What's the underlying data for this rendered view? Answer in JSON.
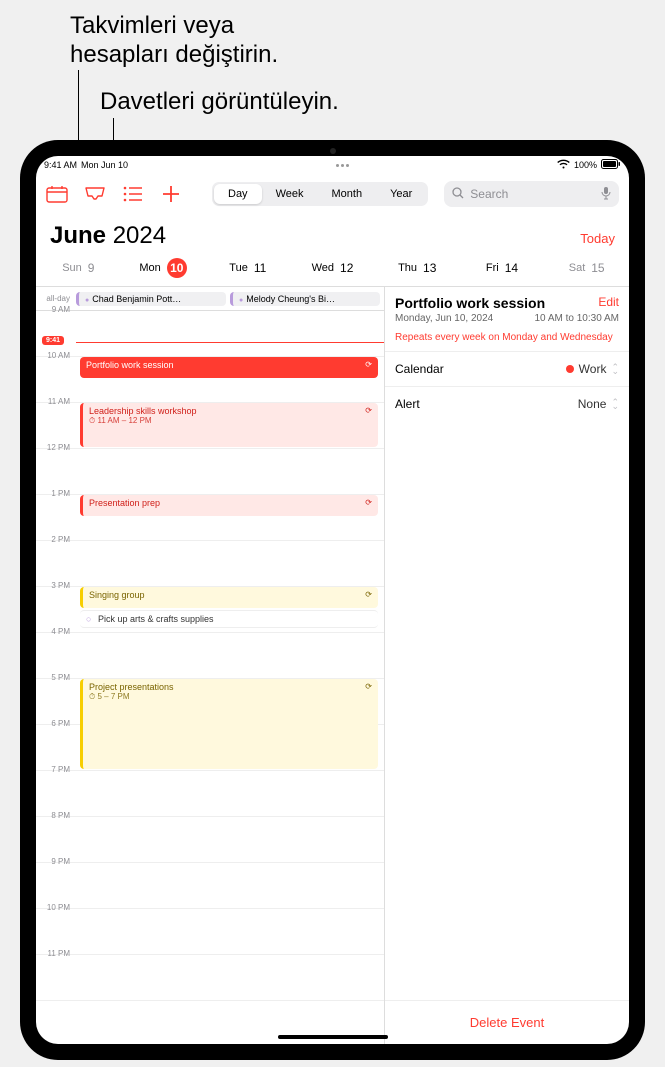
{
  "callouts": {
    "calendars": "Takvimleri veya\nhesapları değiştirin.",
    "invites": "Davetleri görüntüleyin."
  },
  "status": {
    "time": "9:41 AM",
    "date": "Mon Jun 10",
    "battery": "100%"
  },
  "toolbar": {
    "views": {
      "day": "Day",
      "week": "Week",
      "month": "Month",
      "year": "Year"
    },
    "search_placeholder": "Search"
  },
  "header": {
    "month": "June",
    "year": "2024",
    "today": "Today"
  },
  "weekdays": [
    {
      "label": "Sun",
      "num": "9",
      "dim": true
    },
    {
      "label": "Mon",
      "num": "10",
      "selected": true
    },
    {
      "label": "Tue",
      "num": "11"
    },
    {
      "label": "Wed",
      "num": "12"
    },
    {
      "label": "Thu",
      "num": "13"
    },
    {
      "label": "Fri",
      "num": "14"
    },
    {
      "label": "Sat",
      "num": "15",
      "dim": true
    }
  ],
  "allday": {
    "label": "all-day",
    "events": [
      "Chad Benjamin Pott…",
      "Melody Cheung's Bi…"
    ]
  },
  "now": "9:41",
  "hours": [
    "9 AM",
    "10 AM",
    "11 AM",
    "12 PM",
    "1 PM",
    "2 PM",
    "3 PM",
    "4 PM",
    "5 PM",
    "6 PM",
    "7 PM",
    "8 PM",
    "9 PM",
    "10 PM",
    "11 PM"
  ],
  "events": {
    "portfolio": {
      "title": "Portfolio work session"
    },
    "leadership": {
      "title": "Leadership skills workshop",
      "sub": "11 AM – 12 PM"
    },
    "presentation": {
      "title": "Presentation prep"
    },
    "singing": {
      "title": "Singing group"
    },
    "pickup": {
      "title": "Pick up arts & crafts supplies"
    },
    "project": {
      "title": "Project presentations",
      "sub": "5 – 7 PM"
    }
  },
  "detail": {
    "title": "Portfolio work session",
    "edit": "Edit",
    "date": "Monday, Jun 10, 2024",
    "time": "10 AM to 10:30 AM",
    "repeats": "Repeats every week on Monday and Wednesday",
    "calendar_label": "Calendar",
    "calendar_value": "Work",
    "alert_label": "Alert",
    "alert_value": "None",
    "delete": "Delete Event"
  }
}
